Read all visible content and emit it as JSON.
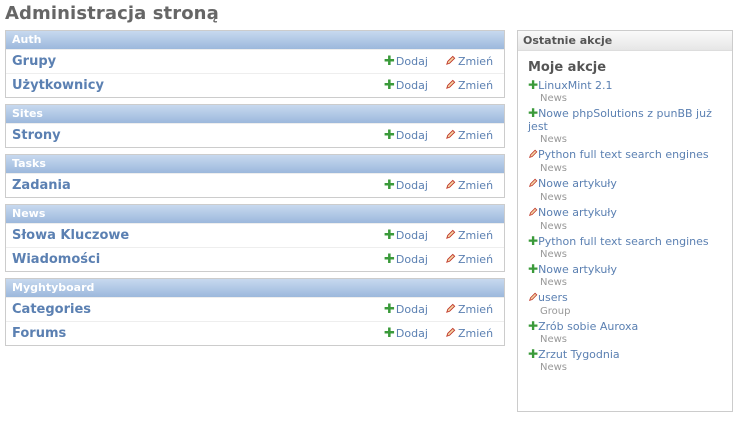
{
  "page": {
    "title": "Administracja stroną"
  },
  "modules": [
    {
      "caption": "Auth",
      "rows": [
        {
          "name": "Grupy",
          "add": "Dodaj",
          "change": "Zmień"
        },
        {
          "name": "Użytkownicy",
          "add": "Dodaj",
          "change": "Zmień"
        }
      ]
    },
    {
      "caption": "Sites",
      "rows": [
        {
          "name": "Strony",
          "add": "Dodaj",
          "change": "Zmień"
        }
      ]
    },
    {
      "caption": "Tasks",
      "rows": [
        {
          "name": "Zadania",
          "add": "Dodaj",
          "change": "Zmień"
        }
      ]
    },
    {
      "caption": "News",
      "rows": [
        {
          "name": "Słowa Kluczowe",
          "add": "Dodaj",
          "change": "Zmień"
        },
        {
          "name": "Wiadomości",
          "add": "Dodaj",
          "change": "Zmień"
        }
      ]
    },
    {
      "caption": "Myghtyboard",
      "rows": [
        {
          "name": "Categories",
          "add": "Dodaj",
          "change": "Zmień"
        },
        {
          "name": "Forums",
          "add": "Dodaj",
          "change": "Zmień"
        }
      ]
    }
  ],
  "sidebar": {
    "caption": "Ostatnie akcje",
    "heading": "Moje akcje",
    "actions": [
      {
        "icon": "plus-icon",
        "text": "LinuxMint 2.1",
        "type": "News"
      },
      {
        "icon": "plus-icon",
        "text": "Nowe phpSolutions z punBB już jest",
        "type": "News"
      },
      {
        "icon": "pencil-icon",
        "text": "Python full text search engines",
        "type": "News"
      },
      {
        "icon": "pencil-icon",
        "text": "Nowe artykuły",
        "type": "News"
      },
      {
        "icon": "pencil-icon",
        "text": "Nowe artykuły",
        "type": "News"
      },
      {
        "icon": "plus-icon",
        "text": "Python full text search engines",
        "type": "News"
      },
      {
        "icon": "plus-icon",
        "text": "Nowe artykuły",
        "type": "News"
      },
      {
        "icon": "pencil-icon",
        "text": "users",
        "type": "Group"
      },
      {
        "icon": "plus-icon",
        "text": "Zrób sobie Auroxa",
        "type": "News"
      },
      {
        "icon": "plus-icon",
        "text": "Zrzut Tygodnia",
        "type": "News"
      }
    ]
  },
  "colors": {
    "link": "#5b80b2",
    "add_icon": "#3a9a3a",
    "caption_bg": "#9cb8dc"
  }
}
